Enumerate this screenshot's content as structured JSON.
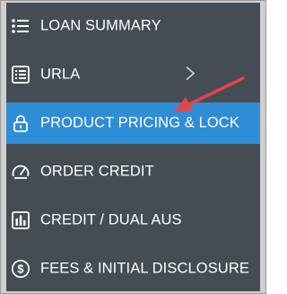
{
  "menu": {
    "items": [
      {
        "label": "LOAN SUMMARY",
        "icon": "list-icon",
        "active": false
      },
      {
        "label": "URLA",
        "icon": "form-icon",
        "active": false,
        "has_submenu": true
      },
      {
        "label": "PRODUCT PRICING & LOCK",
        "icon": "lock-icon",
        "active": true
      },
      {
        "label": "ORDER CREDIT",
        "icon": "gauge-icon",
        "active": false
      },
      {
        "label": "CREDIT / DUAL AUS",
        "icon": "bar-chart-icon",
        "active": false
      },
      {
        "label": "FEES & INITIAL DISCLOSURE",
        "icon": "dollar-icon",
        "active": false
      }
    ]
  },
  "colors": {
    "panel_bg": "#454c54",
    "active_bg": "#2f8dd6",
    "text": "#ffffff",
    "annotation_arrow": "#e8434a"
  }
}
